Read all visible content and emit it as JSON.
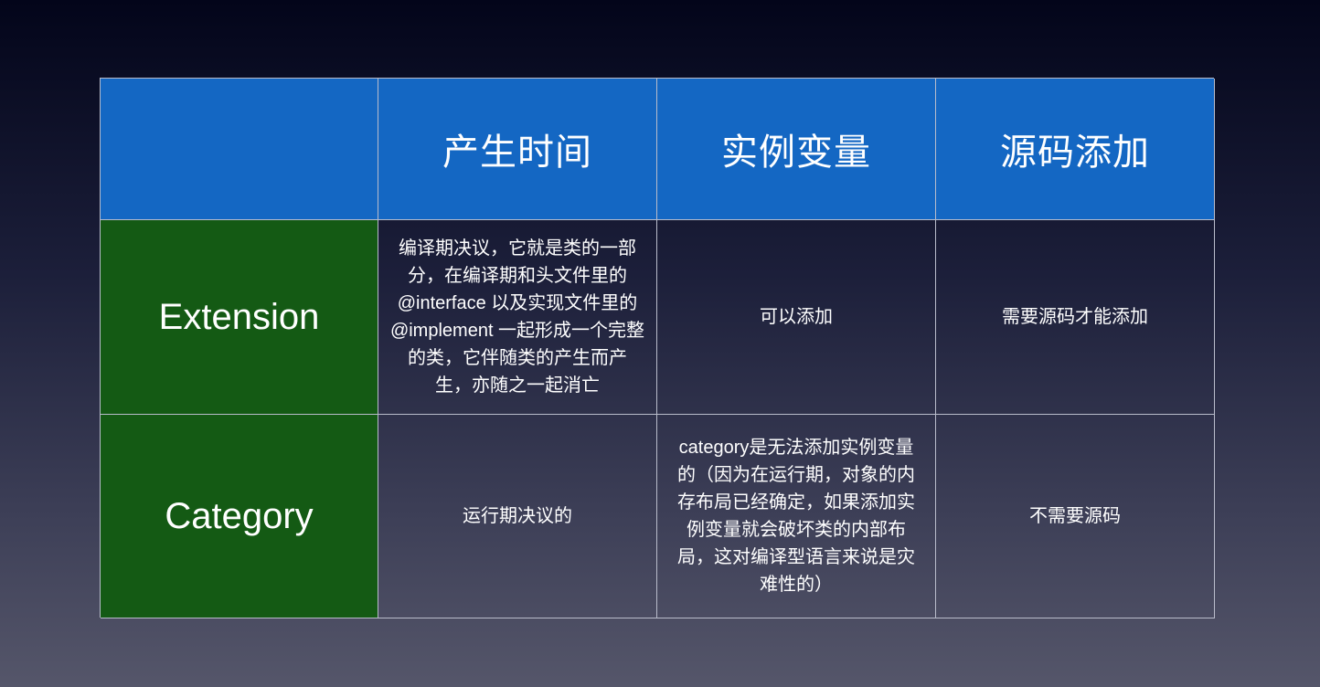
{
  "table": {
    "header": [
      "",
      "产生时间",
      "实例变量",
      "源码添加"
    ],
    "rows": [
      {
        "label": "Extension",
        "time_lines": [
          "编译期决议，它就是类的一部",
          "分，在编译期和头文件里的",
          "@interface 以及实现文件里的",
          "@implement 一起形成一个完整",
          "的类，它伴随类的产生而产",
          "生，亦随之一起消亡"
        ],
        "ivar_lines": [
          "可以添加"
        ],
        "source_lines": [
          "需要源码才能添加"
        ]
      },
      {
        "label": "Category",
        "time_lines": [
          "运行期决议的"
        ],
        "ivar_lines": [
          "category是无法添加实例变量",
          "的（因为在运行期，对象的内",
          "存布局已经确定，如果添加实",
          "例变量就会破坏类的内部布",
          "局，这对编译型语言来说是灾",
          "难性的）"
        ],
        "source_lines": [
          "不需要源码"
        ]
      }
    ]
  },
  "colors": {
    "header_bg": "#1467c3",
    "row_label_bg": "#145a14",
    "border": "#b9bccb"
  }
}
